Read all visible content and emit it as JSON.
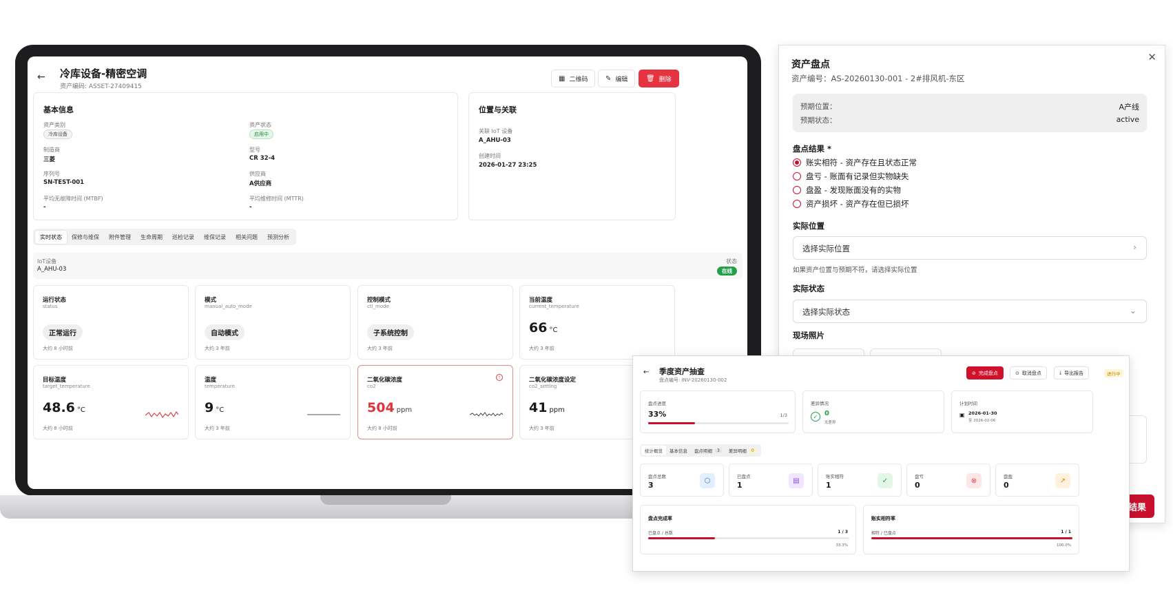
{
  "asset": {
    "title": "冷库设备-精密空调",
    "code": "资产编码: ASSET-27409415",
    "buttons": {
      "qrcode": "二维码",
      "edit": "编辑",
      "delete": "删除"
    }
  },
  "basic": {
    "title": "基本信息",
    "fields": [
      {
        "label": "资产类别",
        "value": "冷库设备"
      },
      {
        "label": "资产状态",
        "value": "启用中"
      },
      {
        "label": "制造商",
        "value": "三菱"
      },
      {
        "label": "型号",
        "value": "CR 32-4"
      },
      {
        "label": "序列号",
        "value": "SN-TEST-001"
      },
      {
        "label": "供应商",
        "value": "A供应商"
      },
      {
        "label": "平均无故障时间 (MTBF)",
        "value": "-"
      },
      {
        "label": "平均维修时间 (MTTR)",
        "value": "-"
      }
    ]
  },
  "location": {
    "title": "位置与关联",
    "iot_label": "关联 IoT 设备",
    "iot_value": "A_AHU-03",
    "created_label": "创建时间",
    "created_value": "2026-01-27 23:25"
  },
  "tabs": [
    "实时状态",
    "保修与维保",
    "附件管理",
    "生命周期",
    "巡检记录",
    "维保记录",
    "相关问题",
    "预测分析"
  ],
  "iot": {
    "label": "IoT设备",
    "device": "A_AHU-03",
    "status_label": "状态",
    "status": "在线"
  },
  "metrics": [
    {
      "name": "运行状态",
      "key": "status",
      "value": "正常运行",
      "unit": "",
      "time": "大约 8 小时前"
    },
    {
      "name": "模式",
      "key": "manual_auto_mode",
      "value": "自动模式",
      "unit": "",
      "time": "大约 3 年前"
    },
    {
      "name": "控制模式",
      "key": "ctl_mode",
      "value": "子系统控制",
      "unit": "",
      "time": "大约 3 年前"
    },
    {
      "name": "当前温度",
      "key": "current_temperature",
      "value": "66",
      "unit": "°C",
      "time": "大约 3 年前"
    },
    {
      "name": "目标温度",
      "key": "target_temperature",
      "value": "48.6",
      "unit": "°C",
      "time": "大约 8 小时前"
    },
    {
      "name": "温度",
      "key": "temperature",
      "value": "9",
      "unit": "°C",
      "time": "大约 3 年前"
    },
    {
      "name": "二氧化碳浓度",
      "key": "co2",
      "value": "504",
      "unit": "ppm",
      "time": "大约 8 小时前"
    },
    {
      "name": "二氧化碳浓度设定",
      "key": "co2_setting",
      "value": "41",
      "unit": "ppm",
      "time": "大约 3 年前"
    }
  ],
  "panel": {
    "title": "资产盘点",
    "subtitle": "资产编号：AS-20260130-001 - 2#排风机-东区",
    "expected_location_label": "预期位置：",
    "expected_location": "A产线",
    "expected_status_label": "预期状态：",
    "expected_status": "active",
    "result_label": "盘点结果 *",
    "options": [
      "账实相符 - 资产存在且状态正常",
      "盘亏 - 账面有记录但实物缺失",
      "盘盈 - 发现账面没有的实物",
      "资产损坏 - 资产存在但已损坏"
    ],
    "actual_location_label": "实际位置",
    "actual_location_placeholder": "选择实际位置",
    "actual_location_hint": "如果资产位置与预期不符，请选择实际位置",
    "actual_status_label": "实际状态",
    "actual_status_placeholder": "选择实际状态",
    "photos_label": "现场照片",
    "submit_partial": "结果"
  },
  "inventory": {
    "title": "季度资产抽查",
    "code": "盘点编号: INV-20260130-002",
    "buttons": {
      "complete": "完成盘点",
      "cancel": "取消盘点",
      "export": "导出报告"
    },
    "status": "进行中",
    "progress_label": "盘点进度",
    "progress_value": "33%",
    "progress_count": "1/3",
    "progress": 0.333,
    "diff_label": "差异情况",
    "diff_value": "0",
    "diff_text": "无差异",
    "plan_label": "计划时间",
    "plan_start": "2026-01-30",
    "plan_end": "至 2026-02-06",
    "tabs": [
      {
        "label": "统计概览",
        "count": ""
      },
      {
        "label": "基本信息",
        "count": ""
      },
      {
        "label": "盘点明细",
        "count": "3"
      },
      {
        "label": "差异明细",
        "count": "0"
      }
    ],
    "stats": [
      {
        "label": "盘点总数",
        "value": "3"
      },
      {
        "label": "已盘点",
        "value": "1"
      },
      {
        "label": "账实相符",
        "value": "1"
      },
      {
        "label": "盘亏",
        "value": "0"
      },
      {
        "label": "盘盈",
        "value": "0"
      }
    ],
    "completion": {
      "title": "盘点完成率",
      "label": "已盘点 / 总数",
      "count": "1 / 3",
      "percent": "33.3%",
      "ratio": 0.333
    },
    "match": {
      "title": "账实相符率",
      "label": "相符 / 已盘点",
      "count": "1 / 1",
      "percent": "100.0%",
      "ratio": 1.0
    }
  }
}
